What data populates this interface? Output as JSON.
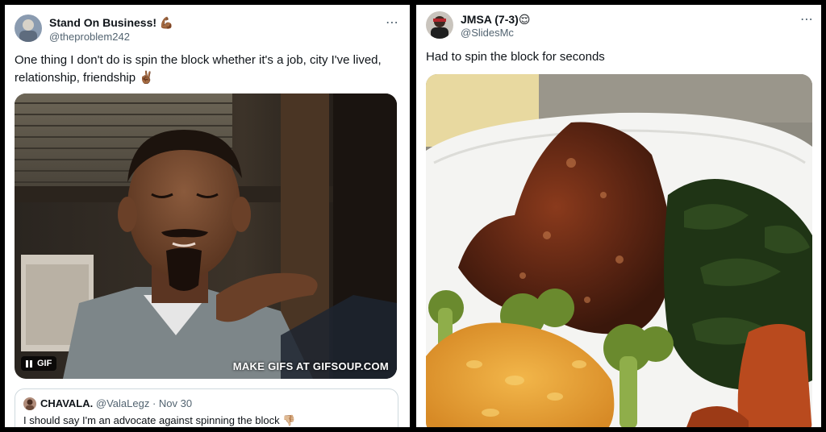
{
  "left_tweet": {
    "display_name": "Stand On Business!",
    "name_emoji": "💪🏾",
    "handle": "@theproblem242",
    "more_icon": "⋯",
    "text": "One thing I don't do is spin the block whether it's a job, city I've lived, relationship, friendship",
    "text_emoji": "✌🏾",
    "media": {
      "type": "gif",
      "badge_label": "GIF",
      "watermark": "MAKE GIFS AT GIFSOUP.COM"
    },
    "quoted_tweet": {
      "display_name": "CHAVALA.",
      "handle": "@ValaLegz",
      "separator": "·",
      "date": "Nov 30",
      "text": "I should say I'm an advocate against spinning the block",
      "text_emoji": "👎🏼"
    }
  },
  "right_tweet": {
    "display_name": "JMSA (7-3)",
    "name_emoji": "😌",
    "handle": "@SlidesMc",
    "more_icon": "⋯",
    "text": "Had to spin the block for seconds",
    "media": {
      "type": "image"
    }
  },
  "colors": {
    "background": "#000000",
    "card": "#ffffff",
    "secondary_text": "#536471",
    "border": "#cfd9de"
  }
}
